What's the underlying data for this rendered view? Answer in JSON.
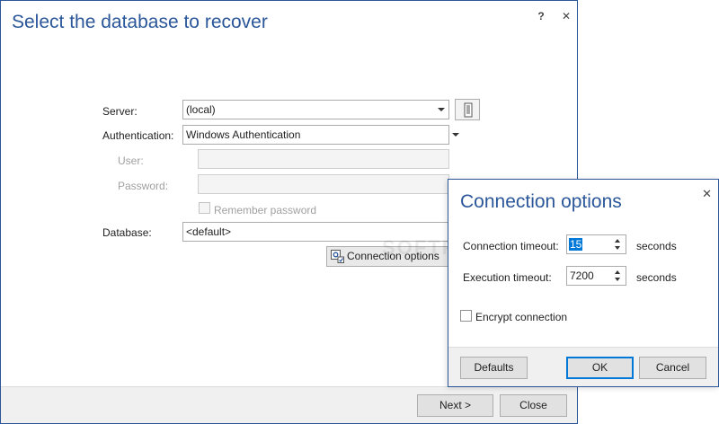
{
  "main": {
    "title": "Select the database to recover",
    "help_label": "?",
    "close_label": "✕",
    "server_label": "Server:",
    "server_value": "(local)",
    "auth_label": "Authentication:",
    "auth_value": "Windows Authentication",
    "user_label": "User:",
    "user_value": "",
    "password_label": "Password:",
    "password_value": "",
    "remember_label": "Remember password",
    "database_label": "Database:",
    "database_value": "<default>",
    "connection_options_label": "Connection options",
    "next_label": "Next >",
    "close_button_label": "Close"
  },
  "popup": {
    "title": "Connection options",
    "close_label": "✕",
    "conn_timeout_label": "Connection timeout:",
    "conn_timeout_value": "15",
    "exec_timeout_label": "Execution timeout:",
    "exec_timeout_value": "7200",
    "seconds_label": "seconds",
    "encrypt_label": "Encrypt connection",
    "defaults_label": "Defaults",
    "ok_label": "OK",
    "cancel_label": "Cancel"
  },
  "watermark": "SOFTPEDIA",
  "colors": {
    "accent": "#2b579a",
    "focus": "#0078d7"
  }
}
